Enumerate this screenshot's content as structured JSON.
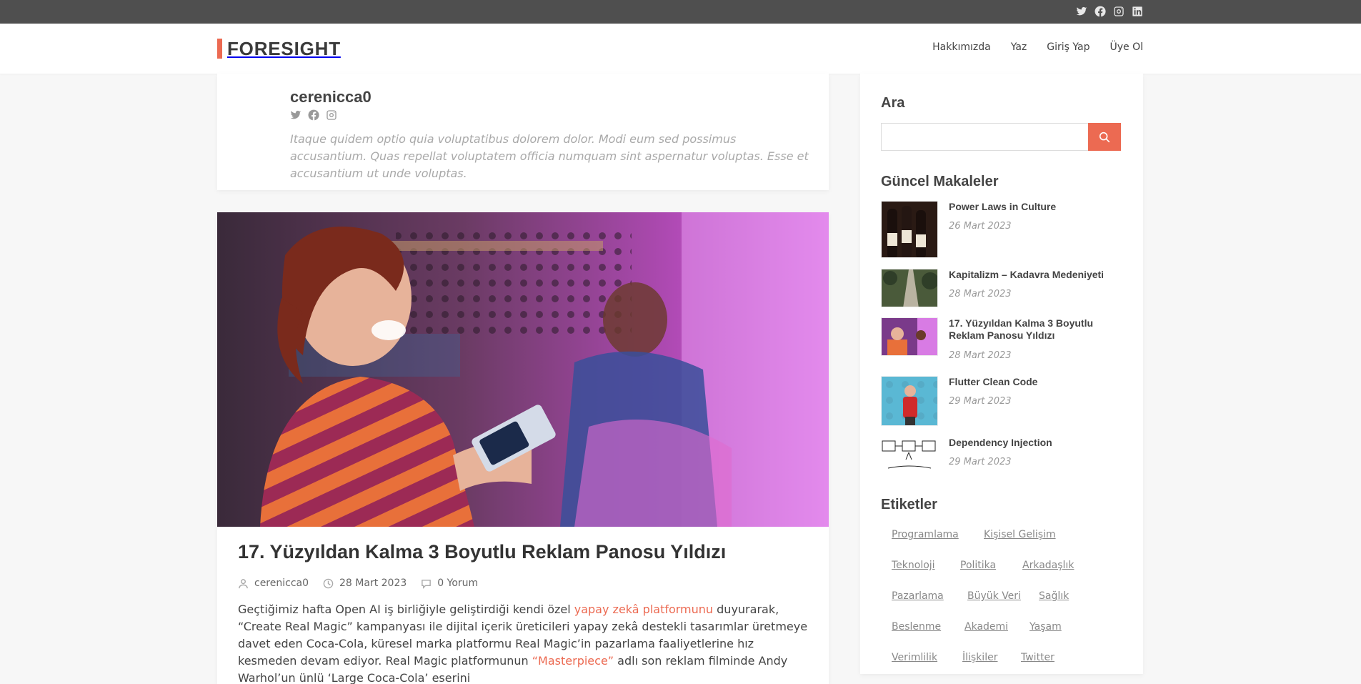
{
  "topbar": {
    "social_icons": [
      "twitter-icon",
      "facebook-icon",
      "instagram-icon",
      "linkedin-icon"
    ]
  },
  "header": {
    "logo_text": "FORESIGHT",
    "nav": [
      "Hakkımızda",
      "Yaz",
      "Giriş Yap",
      "Üye Ol"
    ]
  },
  "author": {
    "name": "cerenicca0",
    "social_icons": [
      "twitter-icon",
      "facebook-icon",
      "instagram-icon"
    ],
    "bio": "Itaque quidem optio quia voluptatibus dolorem dolor. Modi eum sed possimus accusantium. Quas repellat voluptatem officia numquam sint aspernatur voluptas. Esse et accusantium ut unde voluptas."
  },
  "post": {
    "title": "17. Yüzyıldan Kalma 3 Boyutlu Reklam Panosu Yıldızı",
    "author": "cerenicca0",
    "date": "28 Mart 2023",
    "comments": "0 Yorum",
    "excerpt_1": "Geçtiğimiz hafta Open AI iş birliğiyle geliştirdiği kendi özel ",
    "excerpt_link_1": "yapay zekâ platformunu",
    "excerpt_2": " duyurarak, “Create Real Magic” kampanyası ile dijital içerik üreticileri yapay zekâ destekli tasarımlar üretmeye davet eden Coca-Cola, küresel marka platformu Real Magic’in pazarlama faaliyetlerine hız kesmeden devam ediyor. Real Magic platformunun ",
    "excerpt_link_2": "“Masterpiece”",
    "excerpt_3": "  adlı son reklam filminde Andy Warhol’un ünlü ‘Large Coca-Cola’ eserini"
  },
  "sidebar": {
    "search_title": "Ara",
    "search_placeholder": "",
    "recent_title": "Güncel Makaleler",
    "recent": [
      {
        "title": "Power Laws in Culture",
        "date": "26 Mart 2023"
      },
      {
        "title": "Kapitalizm – Kadavra Medeniyeti",
        "date": "28 Mart 2023"
      },
      {
        "title": "17. Yüzyıldan Kalma 3 Boyutlu Reklam Panosu Yıldızı",
        "date": "28 Mart 2023"
      },
      {
        "title": "Flutter Clean Code",
        "date": "29 Mart 2023"
      },
      {
        "title": "Dependency Injection",
        "date": "29 Mart 2023"
      }
    ],
    "tags_title": "Etiketler",
    "tags": [
      "Programlama",
      "Kişisel Gelişim",
      "Teknoloji",
      "Politika",
      "Arkadaşlık",
      "Pazarlama",
      "Büyük Veri",
      "Sağlık",
      "Beslenme",
      "Akademi",
      "Yaşam",
      "Verimlilik",
      "İlişkiler",
      "Twitter"
    ]
  },
  "colors": {
    "accent": "#ec6a52",
    "topbar": "#4f4f4f"
  }
}
